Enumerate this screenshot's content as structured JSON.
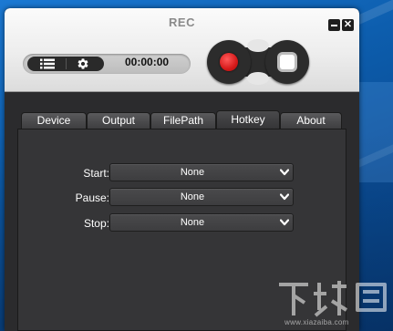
{
  "app": {
    "title": "REC",
    "timer": "00:00:00"
  },
  "window_controls": {
    "minimize_icon": "minimize-icon",
    "close_label": "✕"
  },
  "toolbar": {
    "list_icon": "list-icon",
    "settings_icon": "gear-icon"
  },
  "record_controls": {
    "record_icon": "record-icon",
    "stop_icon": "stop-icon",
    "record_color": "#d61a1a"
  },
  "tabs": [
    {
      "label": "Device"
    },
    {
      "label": "Output"
    },
    {
      "label": "FilePath"
    },
    {
      "label": "Hotkey",
      "active": true
    },
    {
      "label": "About"
    }
  ],
  "hotkeys": {
    "start": {
      "label": "Start:",
      "value": "None"
    },
    "pause": {
      "label": "Pause:",
      "value": "None"
    },
    "stop": {
      "label": "Stop:",
      "value": "None"
    }
  },
  "watermark": {
    "logo": "下载吧",
    "url": "www.xiazaiba.com"
  }
}
